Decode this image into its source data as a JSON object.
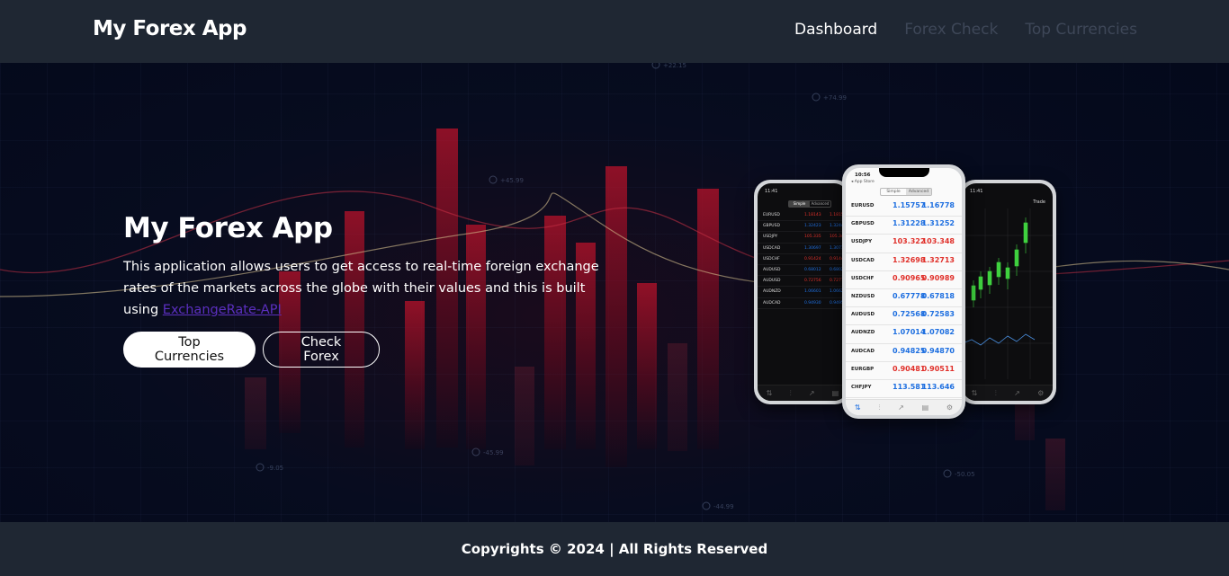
{
  "header": {
    "brand": "My Forex App",
    "nav": [
      {
        "label": "Dashboard",
        "active": true
      },
      {
        "label": "Forex Check",
        "active": false
      },
      {
        "label": "Top Currencies",
        "active": false
      }
    ]
  },
  "hero": {
    "title": "My Forex App",
    "description_prefix": "This application allows users to get access to real-time foreign exchange rates of the markets across the globe with their values and this is built using ",
    "link_text": "ExchangeRate-API",
    "buttons": {
      "primary": "Top Currencies",
      "secondary": "Check Forex"
    }
  },
  "background_labels": {
    "top": "+22.15",
    "upper": "+74.99",
    "left_mid": "+45.99",
    "bottom_left": "-9.05",
    "bottom_center": "-45.99",
    "bottom": "-44.99",
    "bottom_right": "-50.05"
  },
  "phone_center": {
    "time": "10:56",
    "title": "App Store",
    "tabs": [
      "Simple",
      "Advanced"
    ],
    "quotes": [
      {
        "symbol": "EURUSD",
        "bid": "1.15757",
        "ask": "1.16778",
        "bid_color": "blue",
        "ask_color": "blue"
      },
      {
        "symbol": "GBPUSD",
        "bid": "1.31228",
        "ask": "1.31252",
        "bid_color": "blue",
        "ask_color": "blue"
      },
      {
        "symbol": "USDJPY",
        "bid": "103.322",
        "ask": "103.348",
        "bid_color": "red",
        "ask_color": "red"
      },
      {
        "symbol": "USDCAD",
        "bid": "1.32698",
        "ask": "1.32713",
        "bid_color": "red",
        "ask_color": "red"
      },
      {
        "symbol": "USDCHF",
        "bid": "0.90965",
        "ask": "0.90989",
        "bid_color": "red",
        "ask_color": "red"
      },
      {
        "symbol": "NZDUSD",
        "bid": "0.67778",
        "ask": "0.67818",
        "bid_color": "blue",
        "ask_color": "blue"
      },
      {
        "symbol": "AUDUSD",
        "bid": "0.72568",
        "ask": "0.72583",
        "bid_color": "blue",
        "ask_color": "blue"
      },
      {
        "symbol": "AUDNZD",
        "bid": "1.07014",
        "ask": "1.07082",
        "bid_color": "blue",
        "ask_color": "blue"
      },
      {
        "symbol": "AUDCAD",
        "bid": "0.94825",
        "ask": "0.94870",
        "bid_color": "blue",
        "ask_color": "blue"
      },
      {
        "symbol": "EURGBP",
        "bid": "0.90481",
        "ask": "0.90511",
        "bid_color": "red",
        "ask_color": "red"
      },
      {
        "symbol": "CHFJPY",
        "bid": "113.581",
        "ask": "113.646",
        "bid_color": "blue",
        "ask_color": "blue"
      }
    ]
  },
  "phone_left": {
    "time": "11:41",
    "tabs": [
      "Simple",
      "Advanced"
    ],
    "quotes": [
      {
        "symbol": "EURUSD",
        "bid": "1.18143",
        "ask": "1.18155",
        "color": "red"
      },
      {
        "symbol": "GBPUSD",
        "bid": "1.32423",
        "ask": "1.32440",
        "color": "blue"
      },
      {
        "symbol": "USDJPY",
        "bid": "105.335",
        "ask": "105.349",
        "color": "red"
      },
      {
        "symbol": "USDCAD",
        "bid": "1.30697",
        "ask": "1.30711",
        "color": "blue"
      },
      {
        "symbol": "USDCHF",
        "bid": "0.91424",
        "ask": "0.91440",
        "color": "red"
      },
      {
        "symbol": "AUDUSD",
        "bid": "0.68012",
        "ask": "0.68026",
        "color": "blue"
      },
      {
        "symbol": "AUDUSD",
        "bid": "0.72756",
        "ask": "0.72771",
        "color": "red"
      },
      {
        "symbol": "AUDNZD",
        "bid": "1.06601",
        "ask": "1.06621",
        "color": "blue"
      },
      {
        "symbol": "AUDCAD",
        "bid": "0.94930",
        "ask": "0.94950",
        "color": "blue"
      }
    ]
  },
  "phone_right": {
    "time": "11:41",
    "label": "Trade"
  },
  "footer": {
    "text": "Copyrights © 2024 | All Rights Reserved"
  }
}
